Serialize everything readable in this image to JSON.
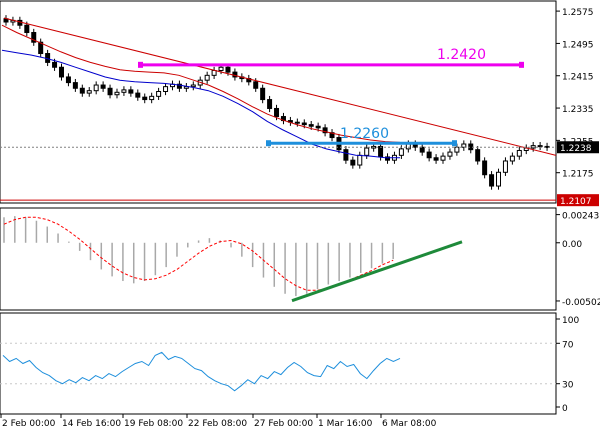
{
  "colors": {
    "background": "#ffffff",
    "candle": "#000000",
    "grid": "#c8c8c8",
    "ma_fast": "#0000cc",
    "ma_slow": "#cc0000",
    "trendline": "#cc0000",
    "level_high": "#ee00ee",
    "level_mid": "#1e8fdc",
    "macd_hist": "#a8a8a8",
    "macd_signal": "#ff0000",
    "divergence": "#1e8a3a",
    "oscillator": "#1e8fdc",
    "price_tag_bg": "#000000",
    "price_tag_red": "#cc0000"
  },
  "chart_data": [
    {
      "type": "candlestick",
      "title": "",
      "price_axis_ticks": [
        "1.2575",
        "1.2495",
        "1.2415",
        "1.2335",
        "1.2255",
        "1.2175"
      ],
      "ylim": [
        1.21,
        1.26
      ],
      "current_price": "1.2238",
      "low_marker": "1.2107",
      "levels": [
        {
          "name": "1.2420",
          "value": 1.2442,
          "color": "level_high"
        },
        {
          "name": "1.2260",
          "value": 1.2248,
          "color": "level_mid"
        }
      ],
      "moving_averages": [
        {
          "color": "ma_fast",
          "values": [
            1.2478,
            1.2472,
            1.2466,
            1.2458,
            1.2448,
            1.2436,
            1.2424,
            1.2412,
            1.2404,
            1.24,
            1.2398,
            1.2396,
            1.2392,
            1.2386,
            1.2378,
            1.2364,
            1.2346,
            1.2326,
            1.2302,
            1.2282,
            1.2264,
            1.2246,
            1.2234,
            1.2226,
            1.2218,
            1.2216,
            1.2212,
            1.2212
          ]
        },
        {
          "color": "ma_slow",
          "values": [
            1.254,
            1.2522,
            1.2506,
            1.249,
            1.2474,
            1.246,
            1.2448,
            1.2438,
            1.243,
            1.2426,
            1.2424,
            1.2422,
            1.2416,
            1.2404,
            1.2392,
            1.2376,
            1.2358,
            1.2338,
            1.232,
            1.2306,
            1.2294,
            1.2284,
            1.2276,
            1.2268,
            1.2262,
            1.2256,
            1.2252,
            1.225
          ]
        }
      ],
      "trendline": {
        "from": 1.2558,
        "to": 1.2218
      },
      "closes": [
        1.2548,
        1.2552,
        1.254,
        1.2522,
        1.2498,
        1.247,
        1.2448,
        1.2436,
        1.2412,
        1.2398,
        1.2384,
        1.2372,
        1.2378,
        1.2392,
        1.2384,
        1.2368,
        1.2374,
        1.238,
        1.2372,
        1.2362,
        1.2356,
        1.2364,
        1.2376,
        1.2388,
        1.2394,
        1.2384,
        1.2388,
        1.2392,
        1.2404,
        1.2416,
        1.2428,
        1.2436,
        1.2424,
        1.2412,
        1.2408,
        1.24,
        1.2384,
        1.2356,
        1.2334,
        1.2314,
        1.2304,
        1.23,
        1.2298,
        1.2294,
        1.229,
        1.2286,
        1.2274,
        1.2262,
        1.2232,
        1.2206,
        1.2194,
        1.2218,
        1.2236,
        1.224,
        1.2214,
        1.2206,
        1.2218,
        1.2234,
        1.2246,
        1.2238,
        1.2226,
        1.2212,
        1.2206,
        1.2216,
        1.2226,
        1.2238,
        1.2246,
        1.2232,
        1.2204,
        1.217,
        1.2142,
        1.2176,
        1.2204,
        1.2216,
        1.223,
        1.2236,
        1.2242,
        1.224,
        1.2238
      ]
    },
    {
      "type": "histogram",
      "indicator": "macd",
      "axis_ticks": [
        "0.00243",
        "0.00",
        "-0.00502"
      ],
      "ylim": [
        -0.0058,
        0.003
      ],
      "histogram": [
        0.0022,
        0.0023,
        0.0022,
        0.0019,
        0.0014,
        0.0008,
        0.0001,
        -0.0007,
        -0.0015,
        -0.0023,
        -0.0029,
        -0.0033,
        -0.0035,
        -0.0033,
        -0.0028,
        -0.0021,
        -0.0012,
        -0.0004,
        0.0002,
        0.0004,
        0.0002,
        -0.0004,
        -0.0012,
        -0.0021,
        -0.003,
        -0.0038,
        -0.0044,
        -0.0046,
        -0.0044,
        -0.004,
        -0.0036,
        -0.0033,
        -0.003,
        -0.0026,
        -0.0022,
        -0.0018,
        -0.0014
      ],
      "signal": [
        0.0016,
        0.002,
        0.0022,
        0.0022,
        0.002,
        0.0016,
        0.001,
        0.0003,
        -0.0005,
        -0.0013,
        -0.002,
        -0.0026,
        -0.003,
        -0.0032,
        -0.0031,
        -0.0028,
        -0.0023,
        -0.0016,
        -0.0009,
        -0.0003,
        0.0001,
        0.0002,
        -0.0001,
        -0.0007,
        -0.0015,
        -0.0023,
        -0.0031,
        -0.0037,
        -0.0041,
        -0.0041,
        -0.0039,
        -0.0036,
        -0.0032,
        -0.0028,
        -0.0024,
        -0.0019,
        -0.0015
      ],
      "divergence_line": {
        "from": -0.005,
        "to": 0.0
      }
    },
    {
      "type": "line",
      "indicator": "oscillator",
      "axis_ticks": [
        "100",
        "70",
        "30",
        "0"
      ],
      "ylim": [
        0,
        100
      ],
      "values": [
        58,
        52,
        55,
        50,
        53,
        46,
        41,
        38,
        33,
        30,
        34,
        31,
        36,
        33,
        38,
        35,
        40,
        37,
        42,
        46,
        50,
        52,
        48,
        58,
        61,
        54,
        57,
        55,
        50,
        45,
        43,
        37,
        33,
        30,
        28,
        23,
        28,
        34,
        30,
        38,
        35,
        42,
        39,
        46,
        51,
        47,
        41,
        38,
        37,
        48,
        45,
        52,
        47,
        49,
        40,
        35,
        43,
        50,
        55,
        52,
        55
      ]
    }
  ],
  "x_axis_labels": [
    "2 Feb 00:00",
    "14 Feb 16:00",
    "19 Feb 08:00",
    "22 Feb 08:00",
    "27 Feb 00:00",
    "1 Mar 16:00",
    "6 Mar 08:00"
  ]
}
